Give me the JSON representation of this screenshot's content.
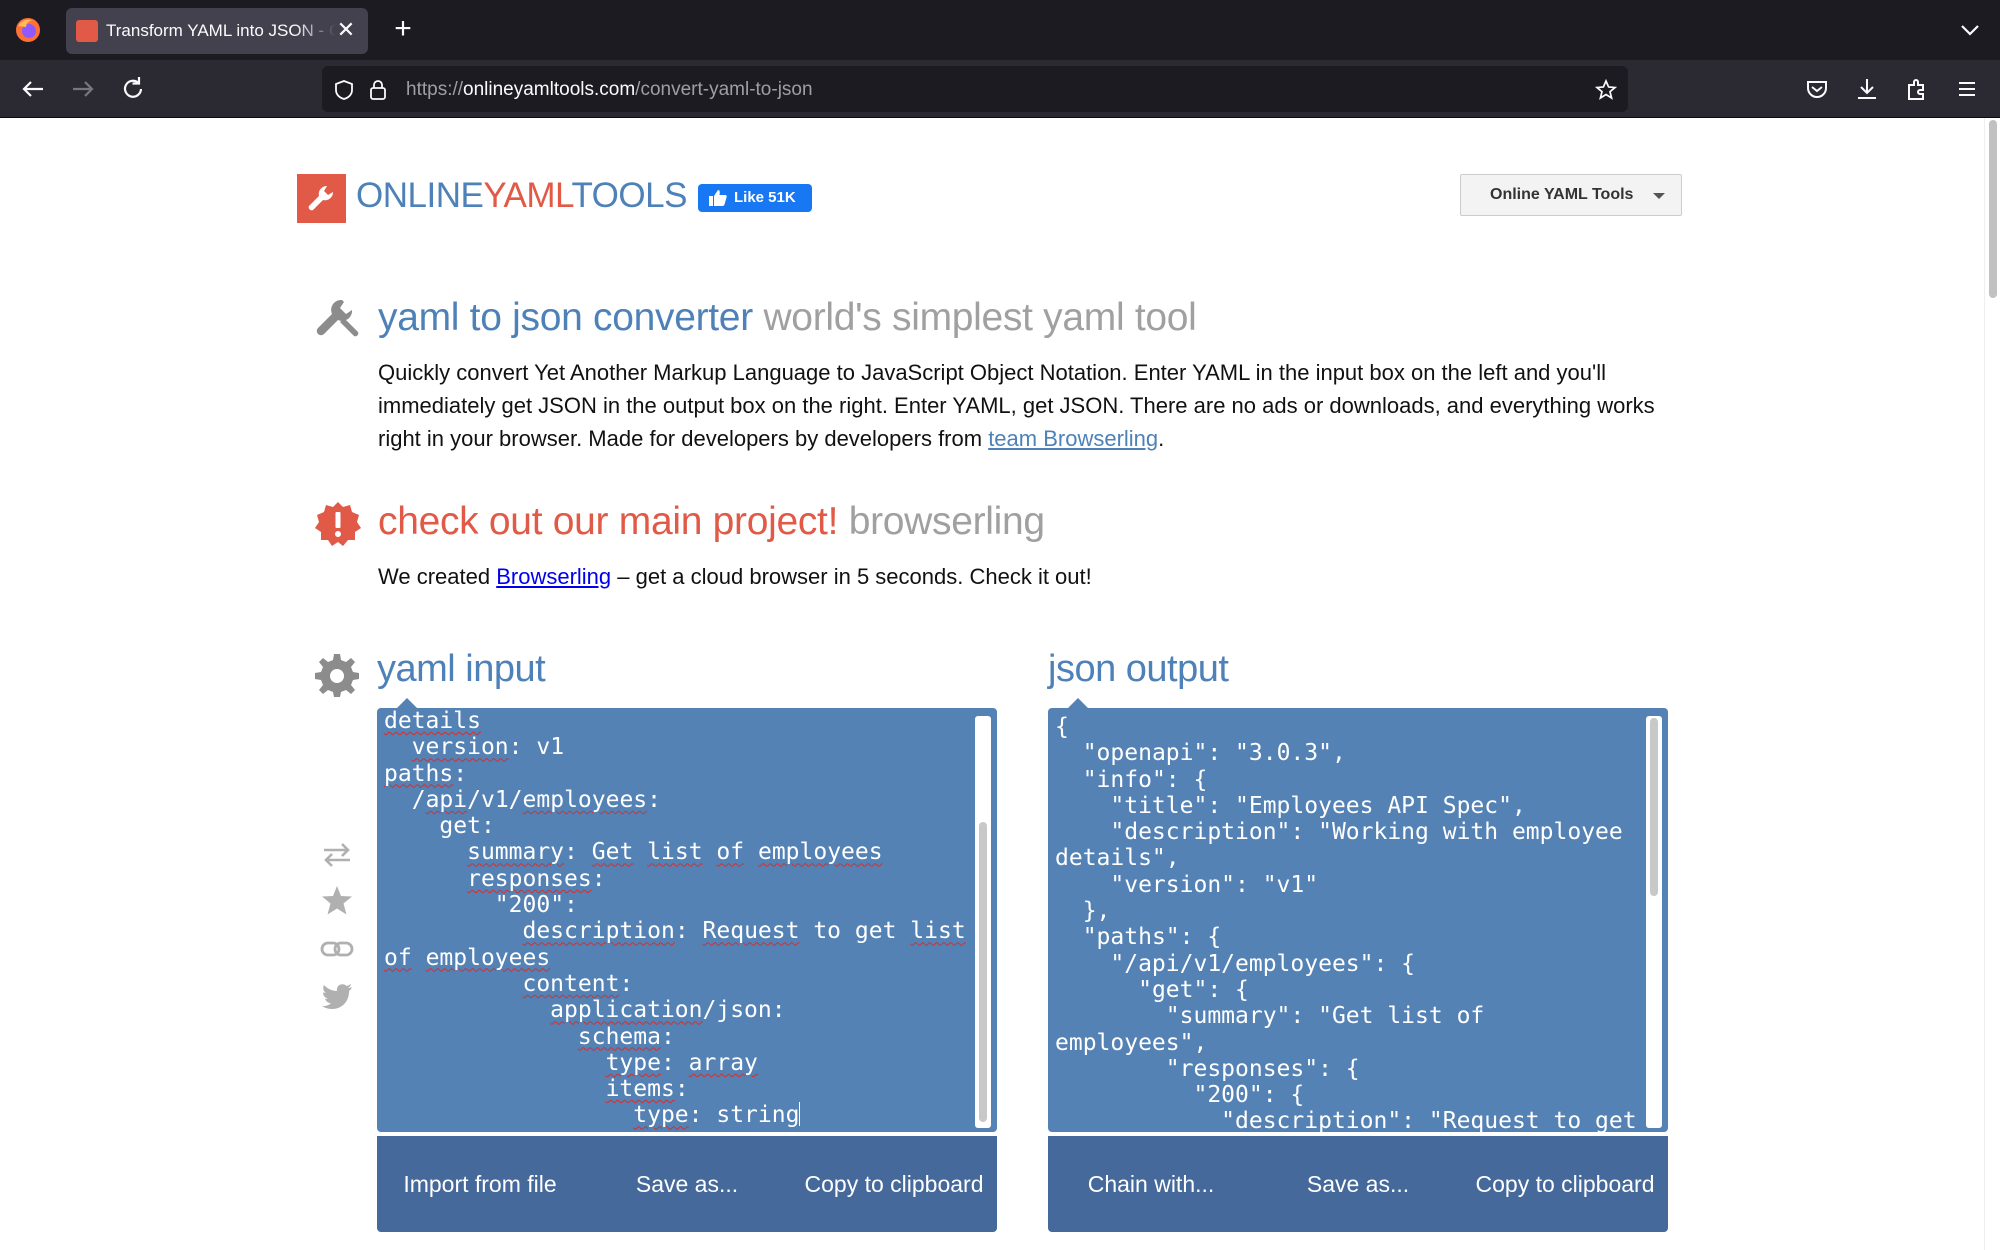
{
  "browser": {
    "tab_title": "Transform YAML into JSON - Online YAML Tools",
    "new_tab_symbol": "+",
    "close_symbol": "✕",
    "url_prefix": "https://",
    "url_domain": "onlineyamltools.com",
    "url_path": "/convert-yaml-to-json"
  },
  "header": {
    "logo_part1": "ONLINE",
    "logo_part2": "YAML",
    "logo_part3": "TOOLS",
    "like_label": "Like 51K",
    "tools_dropdown": "Online YAML Tools"
  },
  "intro": {
    "title": "yaml to json converter",
    "subtitle": "world's simplest yaml tool",
    "text_before_link": "Quickly convert Yet Another Markup Language to JavaScript Object Notation. Enter YAML in the input box on the left and you'll immediately get JSON in the output box on the right. Enter YAML, get JSON. There are no ads or downloads, and everything works right in your browser. Made for developers by developers from ",
    "link": "team Browserling",
    "text_after_link": "."
  },
  "promo": {
    "title": "check out our main project!",
    "subtitle": "browserling",
    "text_before_link": "We created ",
    "link": "Browserling",
    "text_after_link": " – get a cloud browser in 5 seconds. Check it out!"
  },
  "input_panel": {
    "title": "yaml input",
    "buttons": [
      "Import from file",
      "Save as...",
      "Copy to clipboard"
    ]
  },
  "output_panel": {
    "title": "json output",
    "buttons": [
      "Chain with...",
      "Save as...",
      "Copy to clipboard"
    ]
  },
  "yaml_lines": [
    "details",
    "  version: v1",
    "paths:",
    "  /api/v1/employees:",
    "    get:",
    "      summary: Get list of employees",
    "      responses:",
    "        \"200\":",
    "          description: Request to get list of employees",
    "          content:",
    "            application/json:",
    "              schema:",
    "                type: array",
    "                items:",
    "                  type: string"
  ],
  "json_text": "{\n  \"openapi\": \"3.0.3\",\n  \"info\": {\n    \"title\": \"Employees API Spec\",\n    \"description\": \"Working with employee details\",\n    \"version\": \"v1\"\n  },\n  \"paths\": {\n    \"/api/v1/employees\": {\n      \"get\": {\n        \"summary\": \"Get list of employees\",\n        \"responses\": {\n          \"200\": {\n            \"description\": \"Request to get"
}
